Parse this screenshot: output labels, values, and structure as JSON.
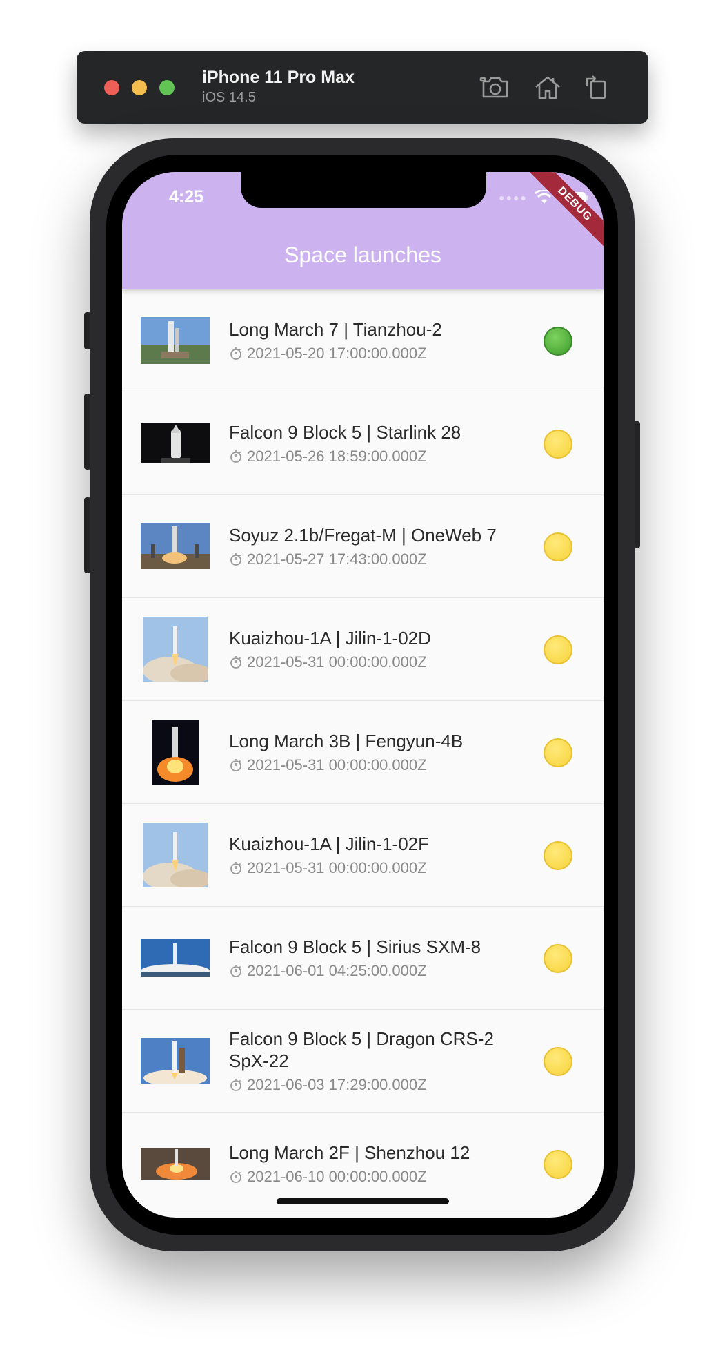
{
  "simulator": {
    "device_name": "iPhone 11 Pro Max",
    "os_version": "iOS 14.5",
    "buttons": [
      "screenshot-icon",
      "home-icon",
      "rotate-icon"
    ]
  },
  "status_bar": {
    "time": "4:25"
  },
  "debug_banner": "DEBUG",
  "app_bar": {
    "title": "Space launches"
  },
  "launches": [
    {
      "title": "Long March 7  | Tianzhou-2",
      "date": "2021-05-20 17:00:00.000Z",
      "status": "green"
    },
    {
      "title": "Falcon 9 Block 5 | Starlink 28",
      "date": "2021-05-26 18:59:00.000Z",
      "status": "yellow"
    },
    {
      "title": "Soyuz 2.1b/Fregat-M | OneWeb 7",
      "date": "2021-05-27 17:43:00.000Z",
      "status": "yellow"
    },
    {
      "title": "Kuaizhou-1A | Jilin-1-02D",
      "date": "2021-05-31 00:00:00.000Z",
      "status": "yellow"
    },
    {
      "title": "Long March 3B | Fengyun-4B",
      "date": "2021-05-31 00:00:00.000Z",
      "status": "yellow"
    },
    {
      "title": "Kuaizhou-1A | Jilin-1-02F",
      "date": "2021-05-31 00:00:00.000Z",
      "status": "yellow"
    },
    {
      "title": "Falcon 9 Block 5 | Sirius SXM-8",
      "date": "2021-06-01 04:25:00.000Z",
      "status": "yellow"
    },
    {
      "title": "Falcon 9 Block 5 | Dragon CRS-2 SpX-22",
      "date": "2021-06-03 17:29:00.000Z",
      "status": "yellow"
    },
    {
      "title": "Long March 2F | Shenzhou 12",
      "date": "2021-06-10 00:00:00.000Z",
      "status": "yellow"
    }
  ],
  "colors": {
    "app_bar": "#ccb3ef",
    "status_green": "#4caf50",
    "status_yellow": "#fbd948",
    "debug_banner": "#a42a3b"
  }
}
